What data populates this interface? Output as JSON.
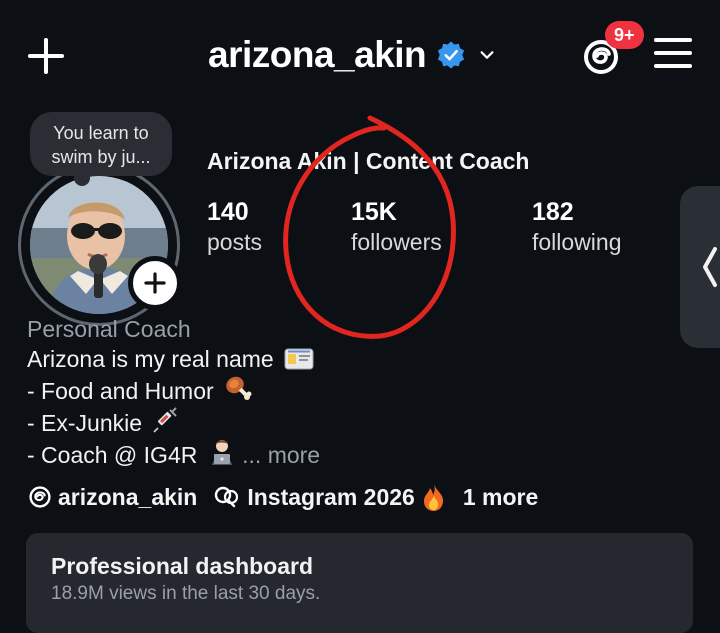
{
  "header": {
    "username": "arizona_akin",
    "notification_badge": "9+"
  },
  "note": {
    "text_line1": "You learn to",
    "text_line2": "swim by ju..."
  },
  "profile": {
    "display_name": "Arizona Akin | Content Coach",
    "stats": [
      {
        "value": "140",
        "label": "posts"
      },
      {
        "value": "15K",
        "label": "followers"
      },
      {
        "value": "182",
        "label": "following"
      }
    ]
  },
  "bio": {
    "category": "Personal Coach",
    "lines": [
      "Arizona is my real name",
      "- Food and Humor",
      "- Ex-Junkie",
      "- Coach @ IG4R"
    ],
    "ellipsis": "...",
    "more_label": "more"
  },
  "links": {
    "threads_handle": "arizona_akin",
    "tag": "Instagram 2026",
    "more": "1 more"
  },
  "dashboard": {
    "title": "Professional dashboard",
    "subtitle": "18.9M views in the last 30 days."
  },
  "colors": {
    "background": "#0c0f14",
    "verified": "#3797f0",
    "badge": "#f0313f",
    "annotation": "#e0261f",
    "muted_text": "#9aa0a8",
    "card": "#25282e"
  }
}
